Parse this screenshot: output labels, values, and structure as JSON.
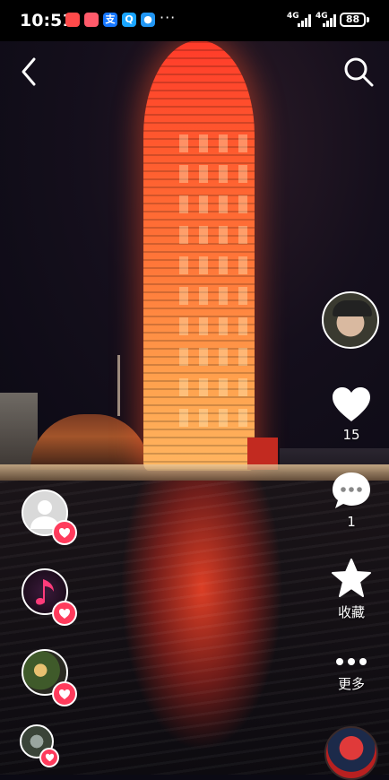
{
  "status_bar": {
    "time": "10:51",
    "more": "···",
    "network1": "4G",
    "network2": "4G",
    "battery": "88",
    "notification_icons": [
      {
        "name": "red-app-icon",
        "color": "#ff4a4a",
        "glyph": ""
      },
      {
        "name": "app-red2-icon",
        "color": "#ff5a6a",
        "glyph": ""
      },
      {
        "name": "alipay-icon",
        "color": "#1677ff",
        "glyph": "支"
      },
      {
        "name": "search-app-icon",
        "color": "#19a5ff",
        "glyph": "Q"
      },
      {
        "name": "chat-app-icon",
        "color": "#2196f3",
        "glyph": "●"
      }
    ]
  },
  "actions": {
    "like_count": "15",
    "comment_count": "1",
    "favorite_label": "收藏",
    "more_label": "更多"
  },
  "colors": {
    "accent": "#ff3b5c",
    "tower": "#ff5a2e"
  }
}
